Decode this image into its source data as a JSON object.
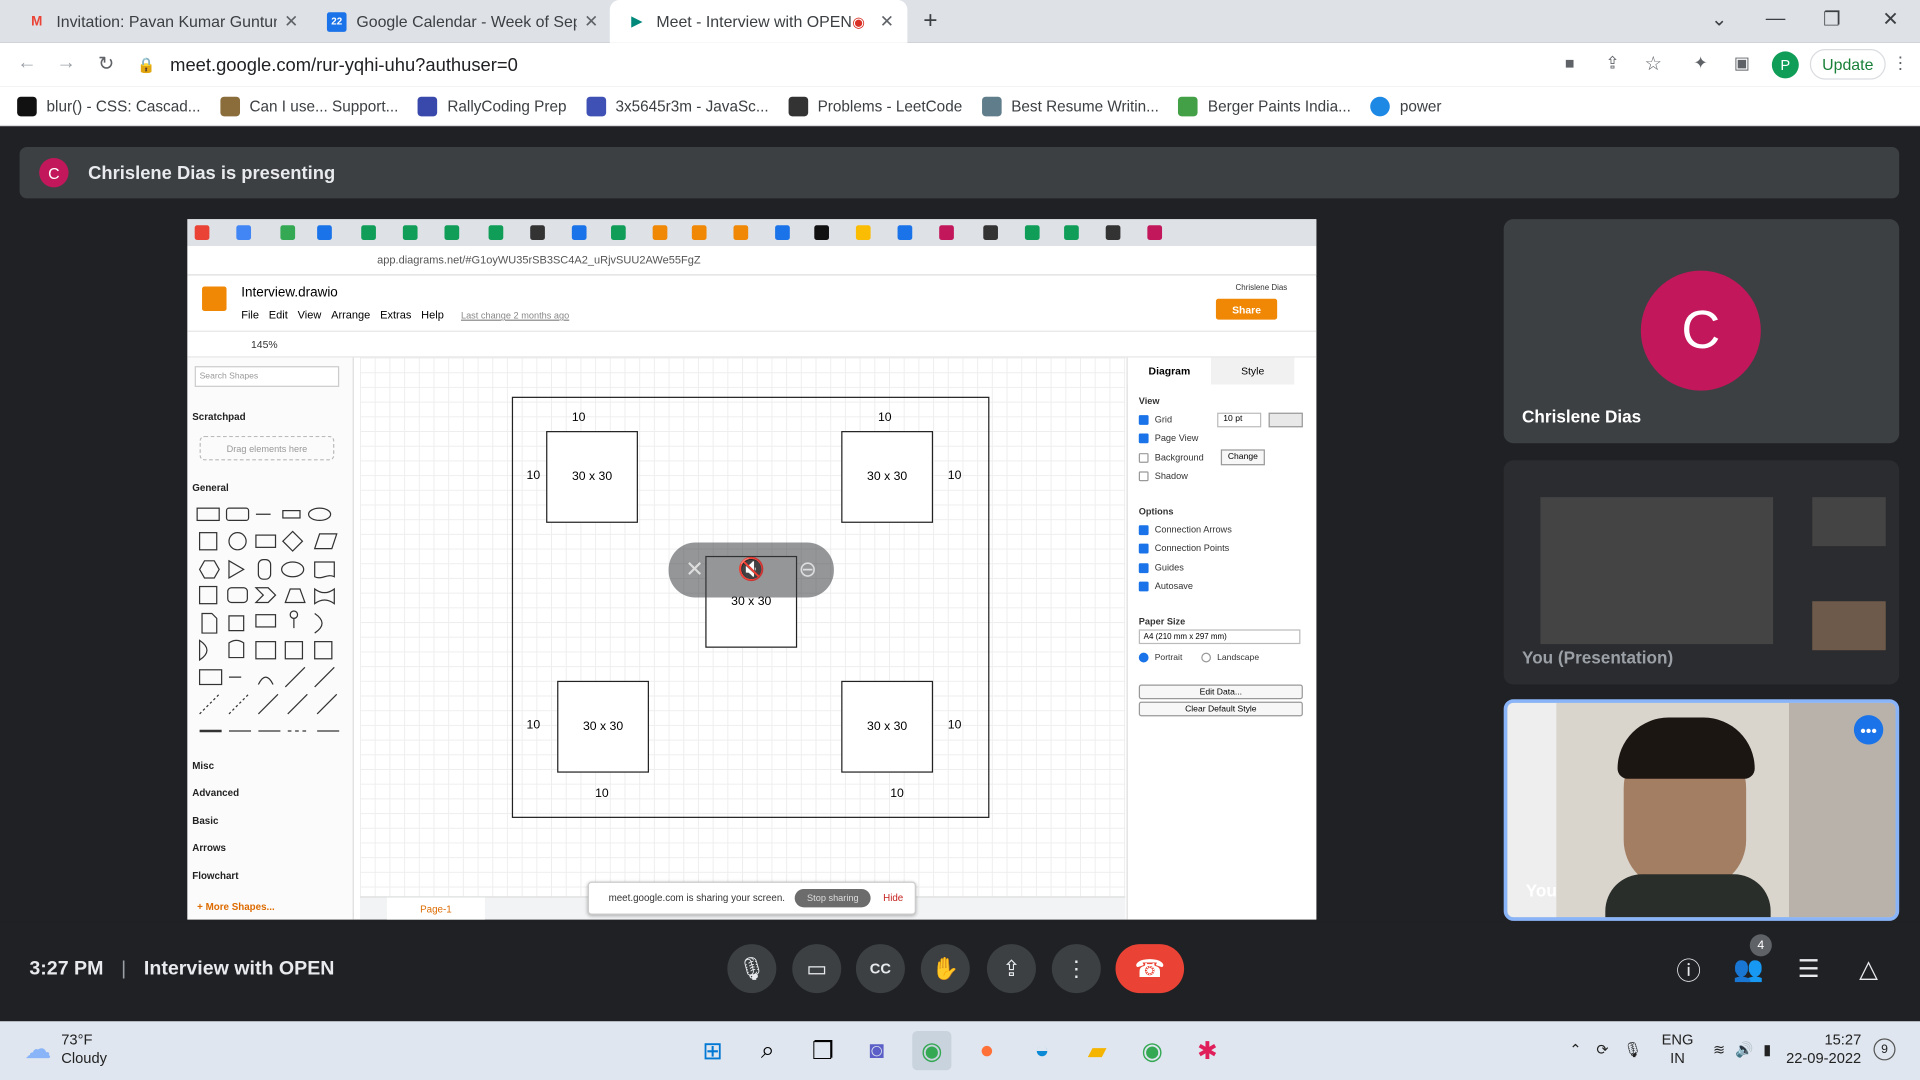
{
  "browser": {
    "tabs": [
      {
        "title": "Invitation: Pavan Kumar Gunturi |",
        "icon": "gmail-icon"
      },
      {
        "title": "Google Calendar - Week of Septe",
        "icon": "calendar-icon"
      },
      {
        "title": "Meet - Interview with OPEN",
        "icon": "meet-icon"
      }
    ],
    "url": "meet.google.com/rur-yqhi-uhu?authuser=0",
    "update_label": "Update",
    "profile_initial": "P",
    "bookmarks": [
      {
        "label": "blur() - CSS: Cascad...",
        "color": "#111111"
      },
      {
        "label": "Can I use... Support...",
        "color": "#8a6d3b"
      },
      {
        "label": "RallyCoding Prep",
        "color": "#3949ab"
      },
      {
        "label": "3x5645r3m - JavaSc...",
        "color": "#3f51b5"
      },
      {
        "label": "Problems - LeetCode",
        "color": "#333333"
      },
      {
        "label": "Best Resume Writin...",
        "color": "#607d8b"
      },
      {
        "label": "Berger Paints India...",
        "color": "#43a047"
      },
      {
        "label": "power",
        "color": "#1e88e5"
      }
    ]
  },
  "meet": {
    "presenting_initial": "C",
    "presenting_text": "Chrislene Dias is presenting",
    "time": "3:27 PM",
    "meeting_name": "Interview with OPEN",
    "participant_count": "4",
    "participants": [
      {
        "initial": "C",
        "name": "Chrislene Dias"
      },
      {
        "name": "You (Presentation)"
      },
      {
        "name": "You"
      }
    ]
  },
  "shared": {
    "url": "app.diagrams.net/#G1oyWU35rSB3SC4A2_uRjvSUU2AWe55FgZ",
    "file_title": "Interview.drawio",
    "menu": [
      "File",
      "Edit",
      "View",
      "Arrange",
      "Extras",
      "Help"
    ],
    "last_change": "Last change 2 months ago",
    "user": "Chrislene Dias",
    "share": "Share",
    "zoom": "145%",
    "search_placeholder": "Search Shapes",
    "scratchpad": "Scratchpad",
    "drag_here": "Drag elements here",
    "sections": [
      "General",
      "Misc",
      "Advanced",
      "Basic",
      "Arrows",
      "Flowchart"
    ],
    "more_shapes": "+ More Shapes...",
    "page_tab": "Page-1",
    "diagram": {
      "box_label": "30 x 30",
      "margin": "10"
    },
    "panel": {
      "tabs": [
        "Diagram",
        "Style"
      ],
      "view": "View",
      "view_opts": [
        "Grid",
        "Page View",
        "Background",
        "Shadow"
      ],
      "grid_size": "10 pt",
      "change": "Change",
      "options": "Options",
      "option_items": [
        "Connection Arrows",
        "Connection Points",
        "Guides",
        "Autosave"
      ],
      "paper_size": "Paper Size",
      "paper_value": "A4 (210 mm x 297 mm)",
      "portrait": "Portrait",
      "landscape": "Landscape",
      "edit_data": "Edit Data...",
      "clear_style": "Clear Default Style"
    },
    "sharing_note": "meet.google.com is sharing your screen.",
    "stop_sharing": "Stop sharing",
    "hide": "Hide"
  },
  "taskbar": {
    "temp": "73°F",
    "weather": "Cloudy",
    "lang1": "ENG",
    "lang2": "IN",
    "time": "15:27",
    "date": "22-09-2022",
    "notif": "9"
  }
}
